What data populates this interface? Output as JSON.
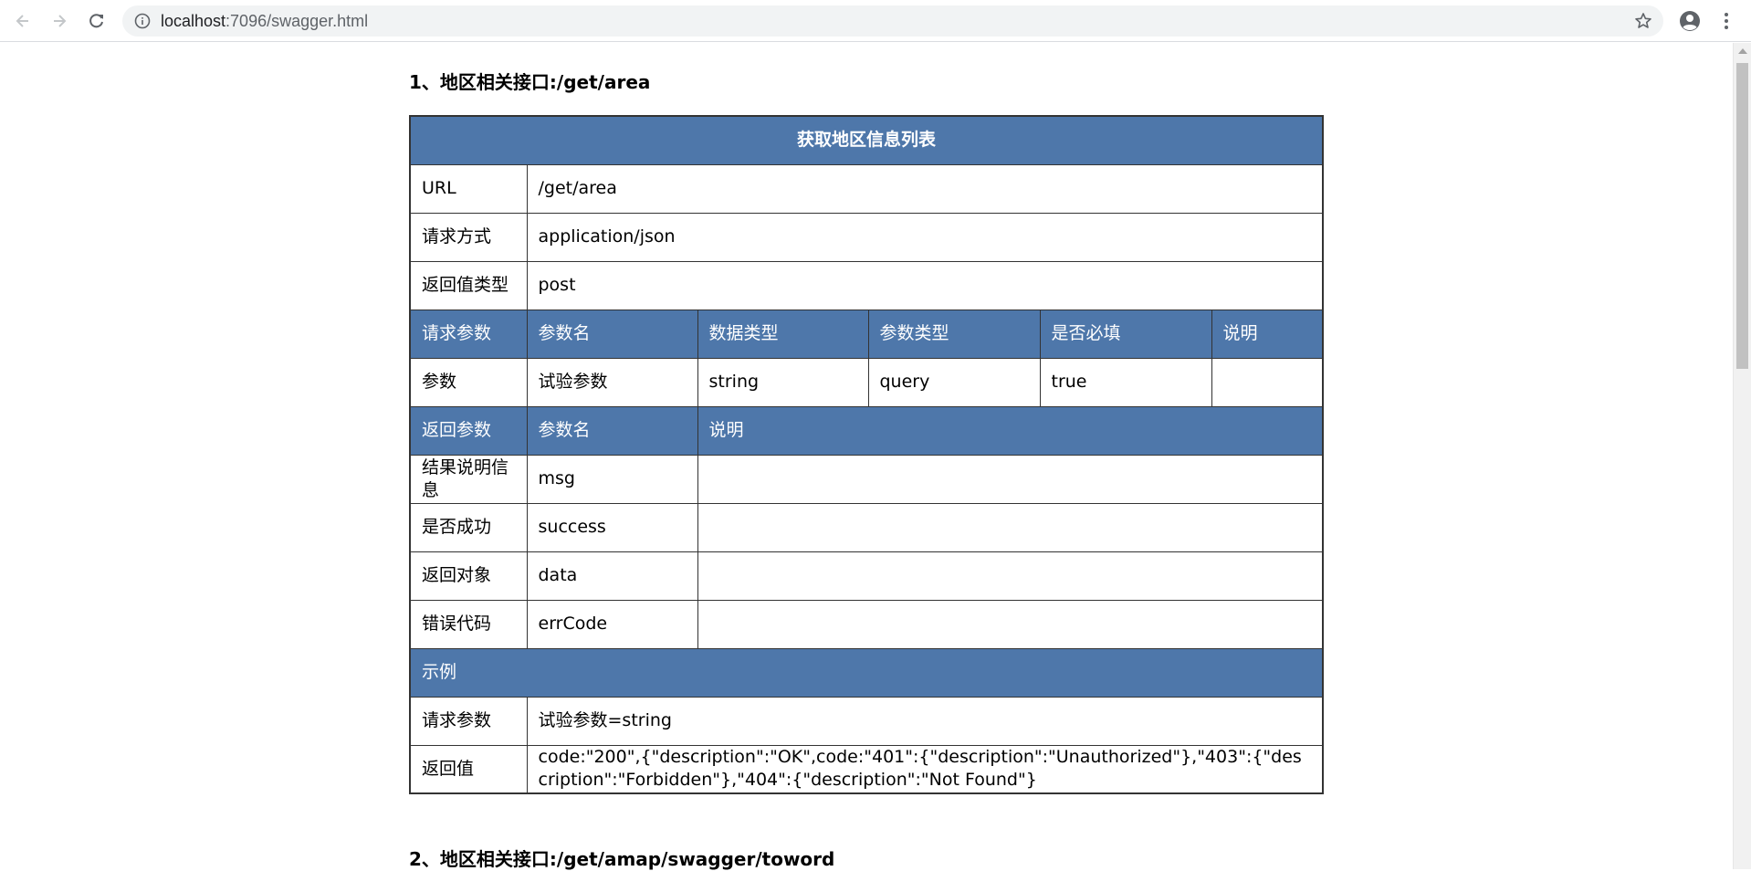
{
  "browser": {
    "url_host": "localhost",
    "url_path": ":7096/swagger.html"
  },
  "sections": [
    {
      "title": "1、地区相关接口:/get/area"
    },
    {
      "title": "2、地区相关接口:/get/amap/swagger/toword"
    }
  ],
  "table": {
    "caption": "获取地区信息列表",
    "url_label": "URL",
    "url_value": "/get/area",
    "method_label": "请求方式",
    "method_value": "application/json",
    "return_type_label": "返回值类型",
    "return_type_value": "post",
    "request_header": [
      "请求参数",
      "参数名",
      "数据类型",
      "参数类型",
      "是否必填",
      "说明"
    ],
    "request_row": [
      "参数",
      "试验参数",
      "string",
      "query",
      "true",
      ""
    ],
    "response_header": [
      "返回参数",
      "参数名",
      "说明"
    ],
    "response_rows": [
      [
        "结果说明信息",
        "msg",
        ""
      ],
      [
        "是否成功",
        "success",
        ""
      ],
      [
        "返回对象",
        "data",
        ""
      ],
      [
        "错误代码",
        "errCode",
        ""
      ]
    ],
    "example_label": "示例",
    "example_request_label": "请求参数",
    "example_request_value": "试验参数=string",
    "example_response_label": "返回值",
    "example_response_value": "code:\"200\",{\"description\":\"OK\",code:\"401\":{\"description\":\"Unauthorized\"},\"403\":{\"description\":\"Forbidden\"},\"404\":{\"description\":\"Not Found\"}"
  },
  "colors": {
    "header_bg": "#4e77aa",
    "border": "#333333"
  },
  "icons": {
    "back": "arrow-left-icon",
    "forward": "arrow-right-icon",
    "reload": "reload-icon",
    "info": "info-icon",
    "star": "star-icon",
    "account": "account-icon",
    "menu": "kebab-menu-icon"
  }
}
